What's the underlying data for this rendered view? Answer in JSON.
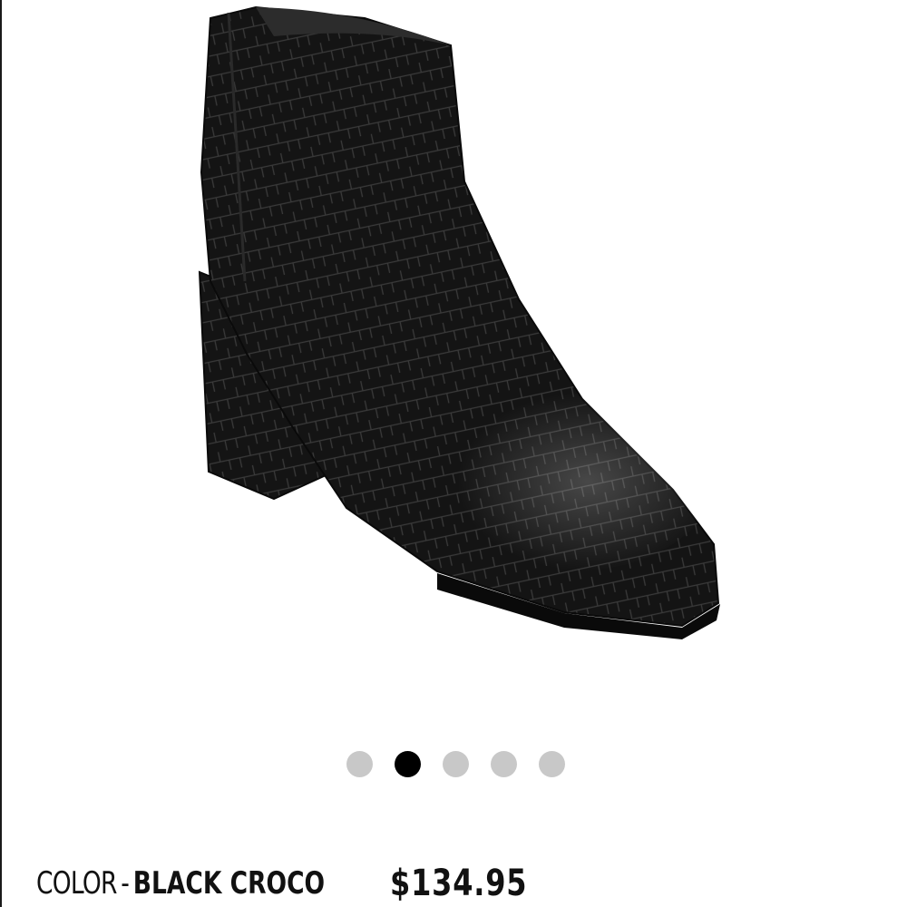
{
  "product": {
    "image_name": "black-croco-ankle-boot",
    "color_label": "COLOR",
    "separator": "-",
    "color_value": "BLACK CROCO",
    "price": "$134.95"
  },
  "carousel": {
    "total": 5,
    "active_index": 1
  },
  "colors": {
    "boot": "#141414",
    "dot_inactive": "#c8c8c8",
    "dot_active": "#000000"
  }
}
